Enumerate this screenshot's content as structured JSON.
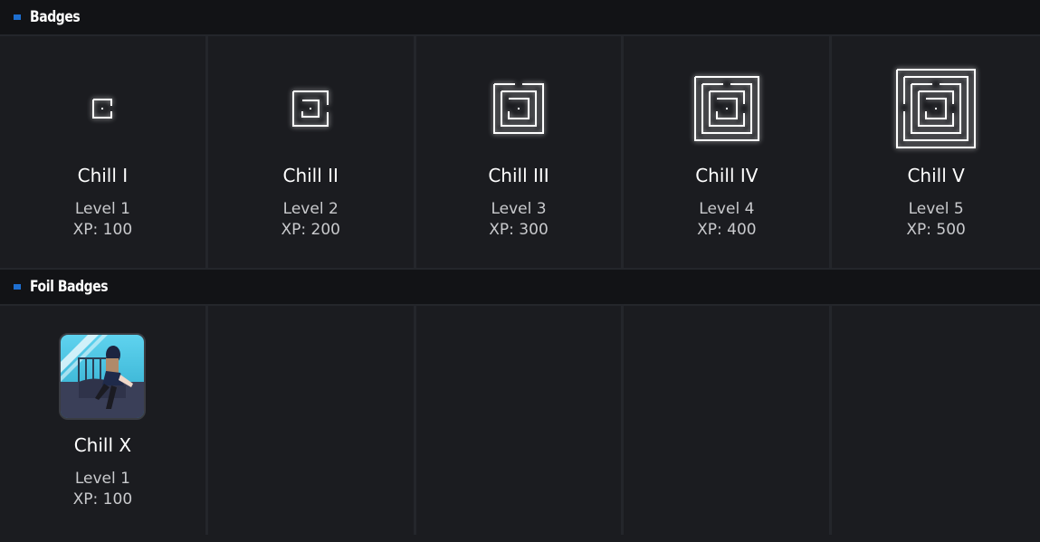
{
  "sections": {
    "badges": {
      "title": "Badges",
      "items": [
        {
          "name": "Chill I",
          "level": "Level 1",
          "xp": "XP: 100",
          "icon": "maze-1-icon"
        },
        {
          "name": "Chill II",
          "level": "Level 2",
          "xp": "XP: 200",
          "icon": "maze-2-icon"
        },
        {
          "name": "Chill III",
          "level": "Level 3",
          "xp": "XP: 300",
          "icon": "maze-3-icon"
        },
        {
          "name": "Chill IV",
          "level": "Level 4",
          "xp": "XP: 400",
          "icon": "maze-4-icon"
        },
        {
          "name": "Chill V",
          "level": "Level 5",
          "xp": "XP: 500",
          "icon": "maze-5-icon"
        }
      ]
    },
    "foil": {
      "title": "Foil Badges",
      "items": [
        {
          "name": "Chill X",
          "level": "Level 1",
          "xp": "XP: 100",
          "icon": "anime-girl-foil-icon"
        }
      ]
    }
  },
  "colors": {
    "accent": "#1e6fd0",
    "background": "#1b1c20",
    "header_bg": "#121316",
    "text_secondary": "#c9cacd"
  }
}
